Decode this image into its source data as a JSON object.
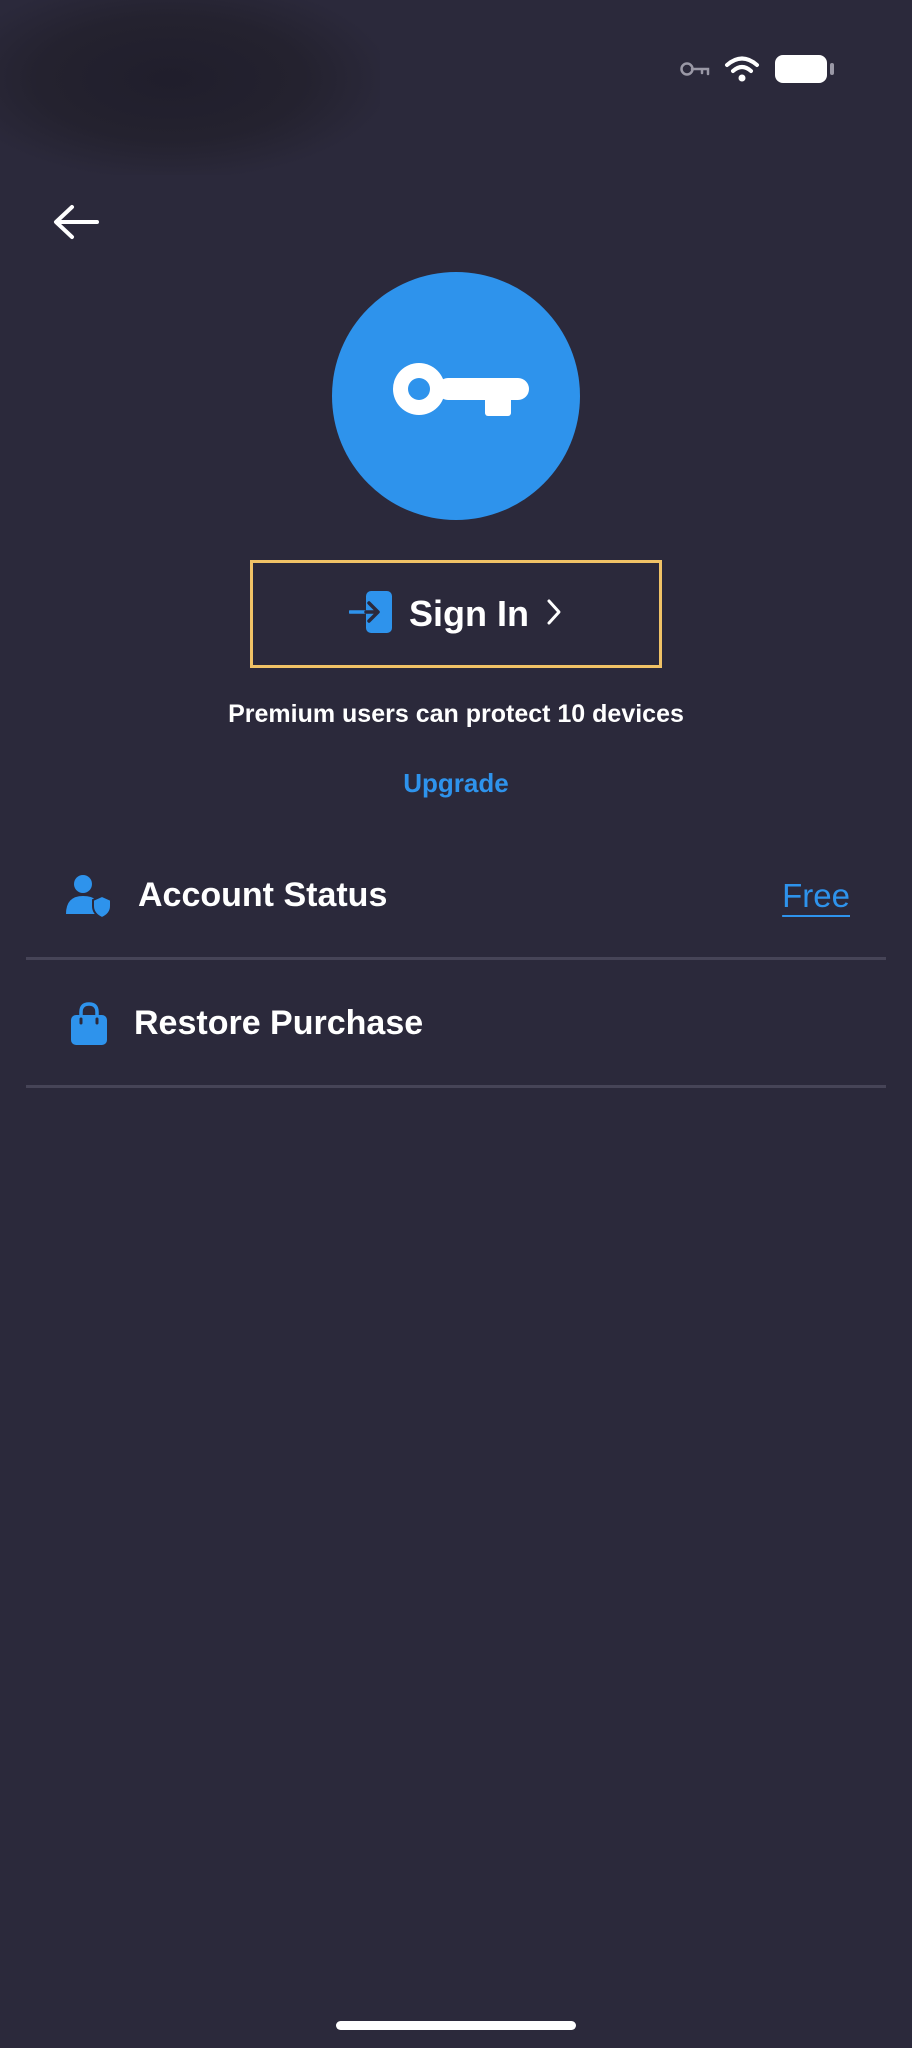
{
  "status_bar": {
    "icons": [
      "vpn-key-icon",
      "wifi-icon",
      "battery-icon"
    ]
  },
  "nav": {
    "back_icon": "arrow-left-icon"
  },
  "hero": {
    "icon": "key-icon",
    "accent_color": "#2e93ec"
  },
  "sign_in": {
    "label": "Sign In",
    "icon": "login-icon",
    "chevron": "chevron-right-icon",
    "highlight_color": "#f0c266"
  },
  "promo": {
    "text": "Premium users can protect 10 devices",
    "upgrade_label": "Upgrade"
  },
  "settings": {
    "account_status": {
      "label": "Account Status",
      "value": "Free",
      "icon": "user-shield-icon"
    },
    "restore_purchase": {
      "label": "Restore Purchase",
      "icon": "shopping-bag-icon"
    }
  },
  "colors": {
    "background": "#2b293b",
    "accent": "#2e93ec",
    "divider": "#464457"
  }
}
